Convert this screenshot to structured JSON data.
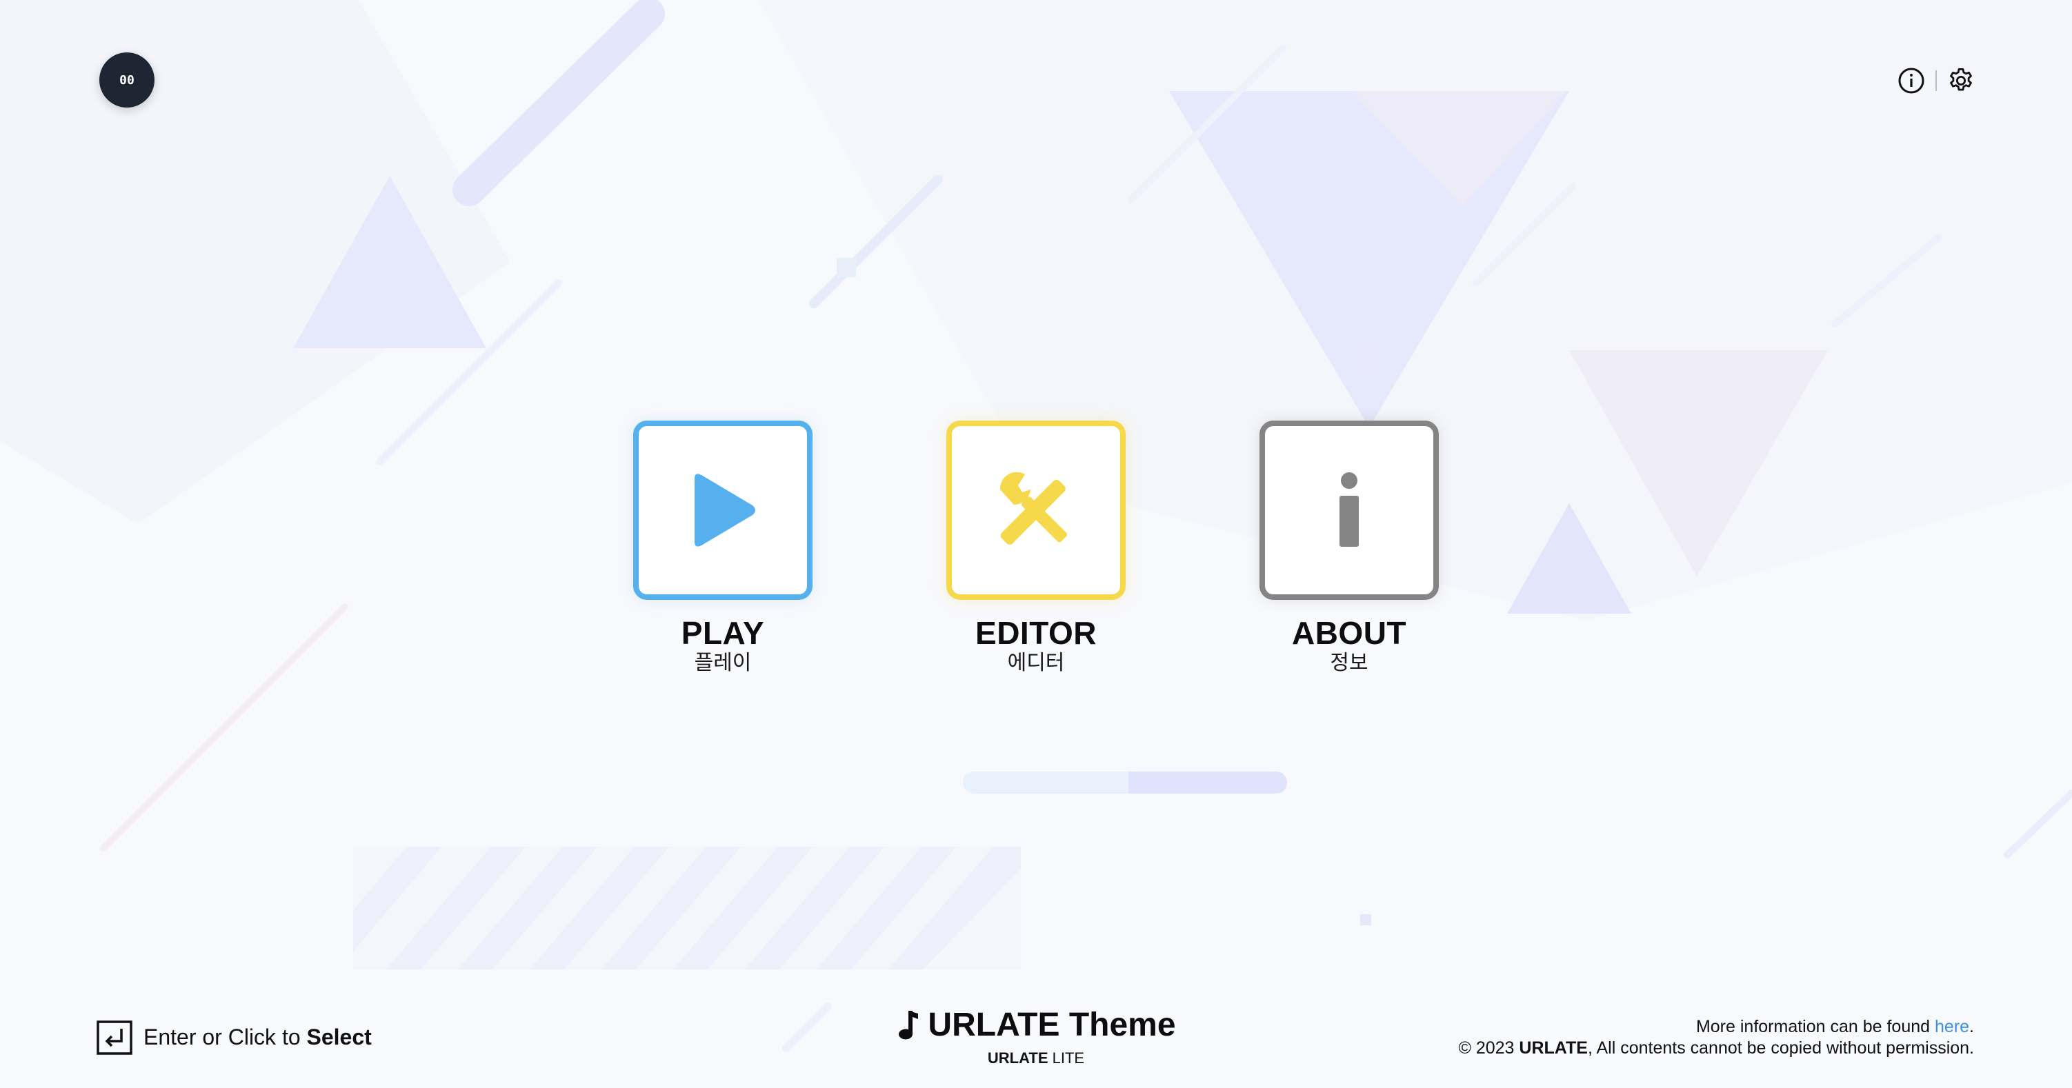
{
  "profile": {
    "initials": "00"
  },
  "header": {
    "info_icon": "info-circle-icon",
    "settings_icon": "gear-icon"
  },
  "menu": {
    "items": [
      {
        "title": "PLAY",
        "subtitle": "플레이",
        "icon": "play-icon",
        "color": "#56b0ee"
      },
      {
        "title": "EDITOR",
        "subtitle": "에디터",
        "icon": "tools-icon",
        "color": "#f6d84b"
      },
      {
        "title": "ABOUT",
        "subtitle": "정보",
        "icon": "info-icon",
        "color": "#848484"
      }
    ]
  },
  "progress": {
    "value": 0.49
  },
  "footer": {
    "hint": {
      "prefix": "Enter or Click to ",
      "action": "Select",
      "icon": "enter-key-icon"
    },
    "theme": {
      "icon": "music-note-icon",
      "name": "URLATE Theme",
      "edition_bold": "URLATE",
      "edition": "LITE"
    },
    "legal": {
      "info_prefix": "More information can be found ",
      "info_link": "here",
      "info_suffix": ".",
      "copyright_prefix": "© 2023 ",
      "brand": "URLATE",
      "copyright_suffix": ", All contents cannot be copied without permission."
    }
  },
  "colors": {
    "background": "#f8f9fd",
    "accent_link": "#3d8fdc",
    "shape_tint": "#e3e7fb"
  }
}
